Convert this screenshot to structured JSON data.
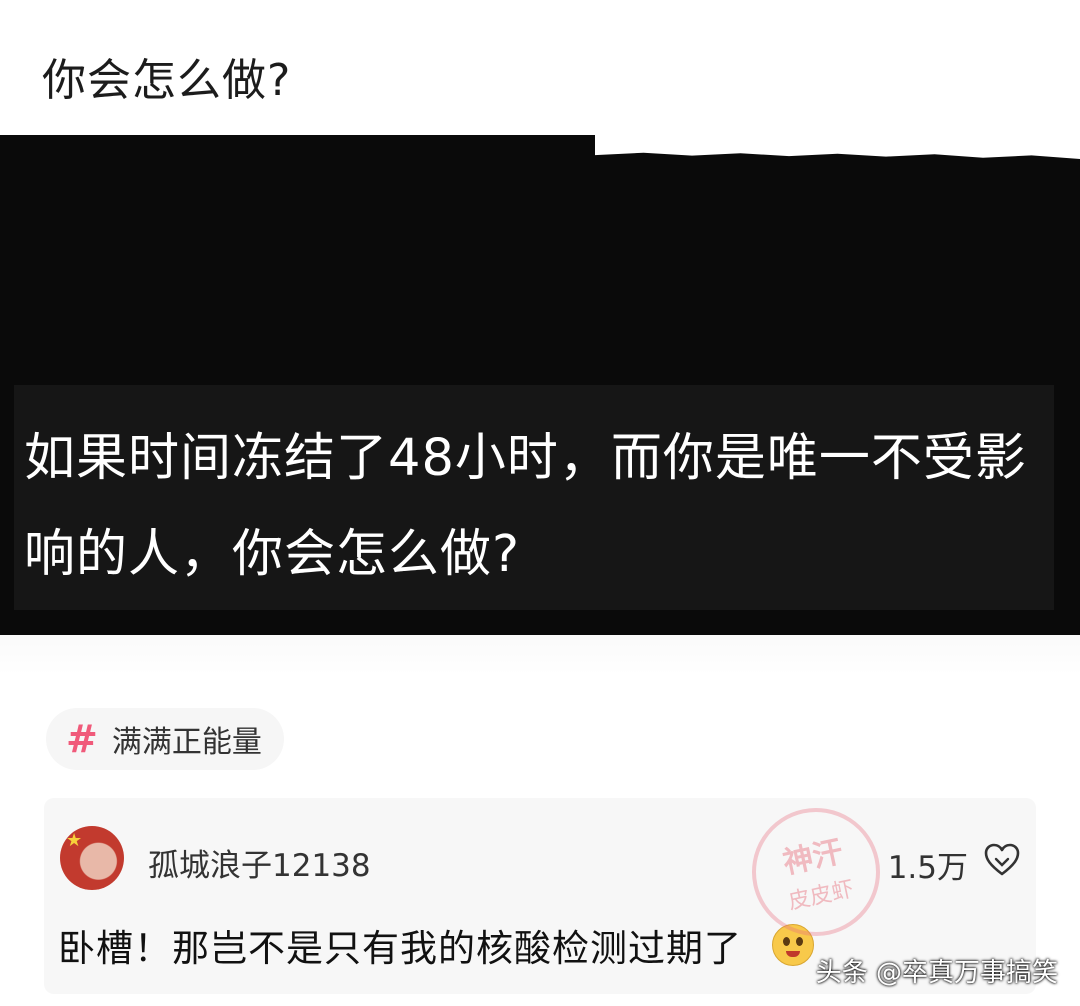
{
  "post": {
    "title": "你会怎么做?"
  },
  "card": {
    "question": "如果时间冻结了48小时，而你是唯一不受影响的人，你会怎么做?"
  },
  "topic": {
    "icon": "hashtag-icon",
    "hash_symbol": "#",
    "label": "满满正能量"
  },
  "comment": {
    "avatar_icon": "avatar-flag-icon",
    "username": "孤城浪子12138",
    "like_count": "1.5万",
    "like_icon": "heart-outline-icon",
    "text": "卧槽！那岂不是只有我的核酸检测过期了",
    "emoji_icon": "shy-face-emoji-icon"
  },
  "watermarks": {
    "stamp_top": "神汗",
    "stamp_bottom": "皮皮虾",
    "source": "头条 @卒真万事搞笑"
  },
  "colors": {
    "card_background": "#0a0a0a",
    "hashtag_accent": "#f05a7a",
    "stamp_color": "#e76e7d"
  }
}
